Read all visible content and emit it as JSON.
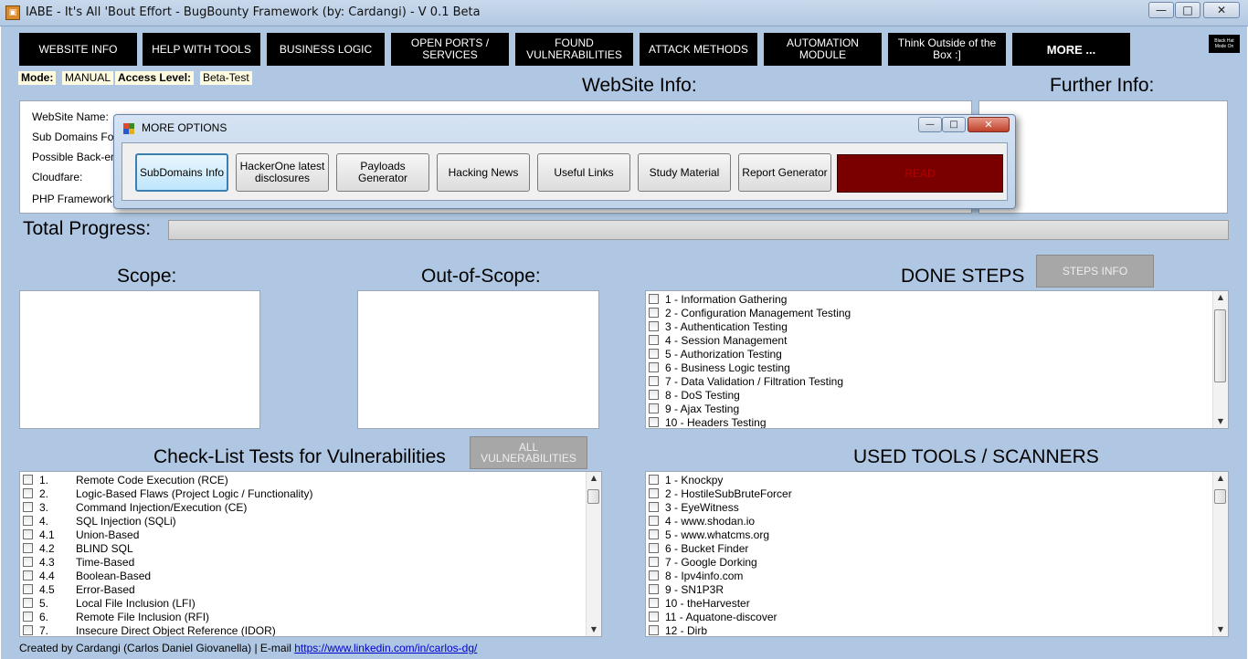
{
  "window": {
    "title": "IABE - It's All 'Bout Effort - BugBounty Framework (by: Cardangi) - V 0.1 Beta",
    "minimize": "—",
    "maximize": "□",
    "close": "✕"
  },
  "nav": [
    {
      "label": "WEBSITE INFO"
    },
    {
      "label": "HELP WITH TOOLS"
    },
    {
      "label": "BUSINESS LOGIC"
    },
    {
      "label": "OPEN PORTS / SERVICES"
    },
    {
      "label": "FOUND VULNERABILITIES"
    },
    {
      "label": "ATTACK METHODS"
    },
    {
      "label": "AUTOMATION MODULE"
    },
    {
      "label": "Think Outside of the Box :]"
    },
    {
      "label": "MORE ..."
    }
  ],
  "blackhat": "Black Hat Mode On",
  "mode": {
    "label": "Mode:",
    "value": "MANUAL",
    "access_label": "Access Level:",
    "access_value": "Beta-Test"
  },
  "website_info": {
    "heading": "WebSite Info:",
    "fields": [
      "WebSite Name:",
      "Sub Domains Foun",
      "Possible Back-end",
      "Cloudfare:",
      "PHP Framework?:"
    ]
  },
  "further_info": {
    "heading": "Further Info:"
  },
  "progress": {
    "label": "Total Progress:",
    "value": 0
  },
  "scope": {
    "heading": "Scope:"
  },
  "out_of_scope": {
    "heading": "Out-of-Scope:"
  },
  "done_steps": {
    "heading": "DONE STEPS",
    "info_button": "STEPS INFO",
    "items": [
      "1 - Information Gathering",
      "2 - Configuration Management Testing",
      "3 - Authentication Testing",
      "4 - Session Management",
      "5 - Authorization Testing",
      "6 - Business Logic testing",
      "7 - Data Validation / Filtration Testing",
      "8 - DoS Testing",
      "9 - Ajax Testing",
      "10 - Headers Testing"
    ]
  },
  "checklist": {
    "heading": "Check-List Tests for Vulnerabilities",
    "all_button": "ALL VULNERABILITIES",
    "items": [
      {
        "num": "1.",
        "text": "Remote Code Execution (RCE)"
      },
      {
        "num": "2.",
        "text": "Logic-Based Flaws (Project Logic / Functionality)"
      },
      {
        "num": "3.",
        "text": "Command Injection/Execution (CE)"
      },
      {
        "num": "4.",
        "text": "SQL Injection (SQLi)"
      },
      {
        "num": "4.1",
        "text": "Union-Based"
      },
      {
        "num": "4.2",
        "text": "BLIND SQL"
      },
      {
        "num": "4.3",
        "text": "Time-Based"
      },
      {
        "num": "4.4",
        "text": "Boolean-Based"
      },
      {
        "num": "4.5",
        "text": "Error-Based"
      },
      {
        "num": "5.",
        "text": "Local File Inclusion (LFI)"
      },
      {
        "num": "6.",
        "text": "Remote File Inclusion (RFI)"
      },
      {
        "num": "7.",
        "text": "Insecure Direct Object Reference (IDOR)"
      }
    ]
  },
  "tools": {
    "heading": "USED TOOLS / SCANNERS",
    "items": [
      "1 - Knockpy",
      "2 - HostileSubBruteForcer",
      "3 - EyeWitness",
      "4 - www.shodan.io",
      "5 - www.whatcms.org",
      "6 - Bucket Finder",
      "7 - Google Dorking",
      "8 - Ipv4info.com",
      "9 - SN1P3R",
      "10 - theHarvester",
      "11 - Aquatone-discover",
      "12 - Dirb"
    ]
  },
  "dialog": {
    "title": "MORE OPTIONS",
    "buttons": [
      {
        "label": "SubDomains Info"
      },
      {
        "label": "HackerOne latest disclosures"
      },
      {
        "label": "Payloads Generator"
      },
      {
        "label": "Hacking News"
      },
      {
        "label": "Useful Links"
      },
      {
        "label": "Study Material"
      },
      {
        "label": "Report Generator"
      }
    ],
    "red_button": "READ"
  },
  "footer": {
    "text": "Created by Cardangi (Carlos Daniel Giovanella) | E-mail ",
    "link": "https://www.linkedin.com/in/carlos-dg/"
  },
  "colors": {
    "background": "#afc7e2",
    "nav": "#000000",
    "read_button": "#7a0000"
  }
}
